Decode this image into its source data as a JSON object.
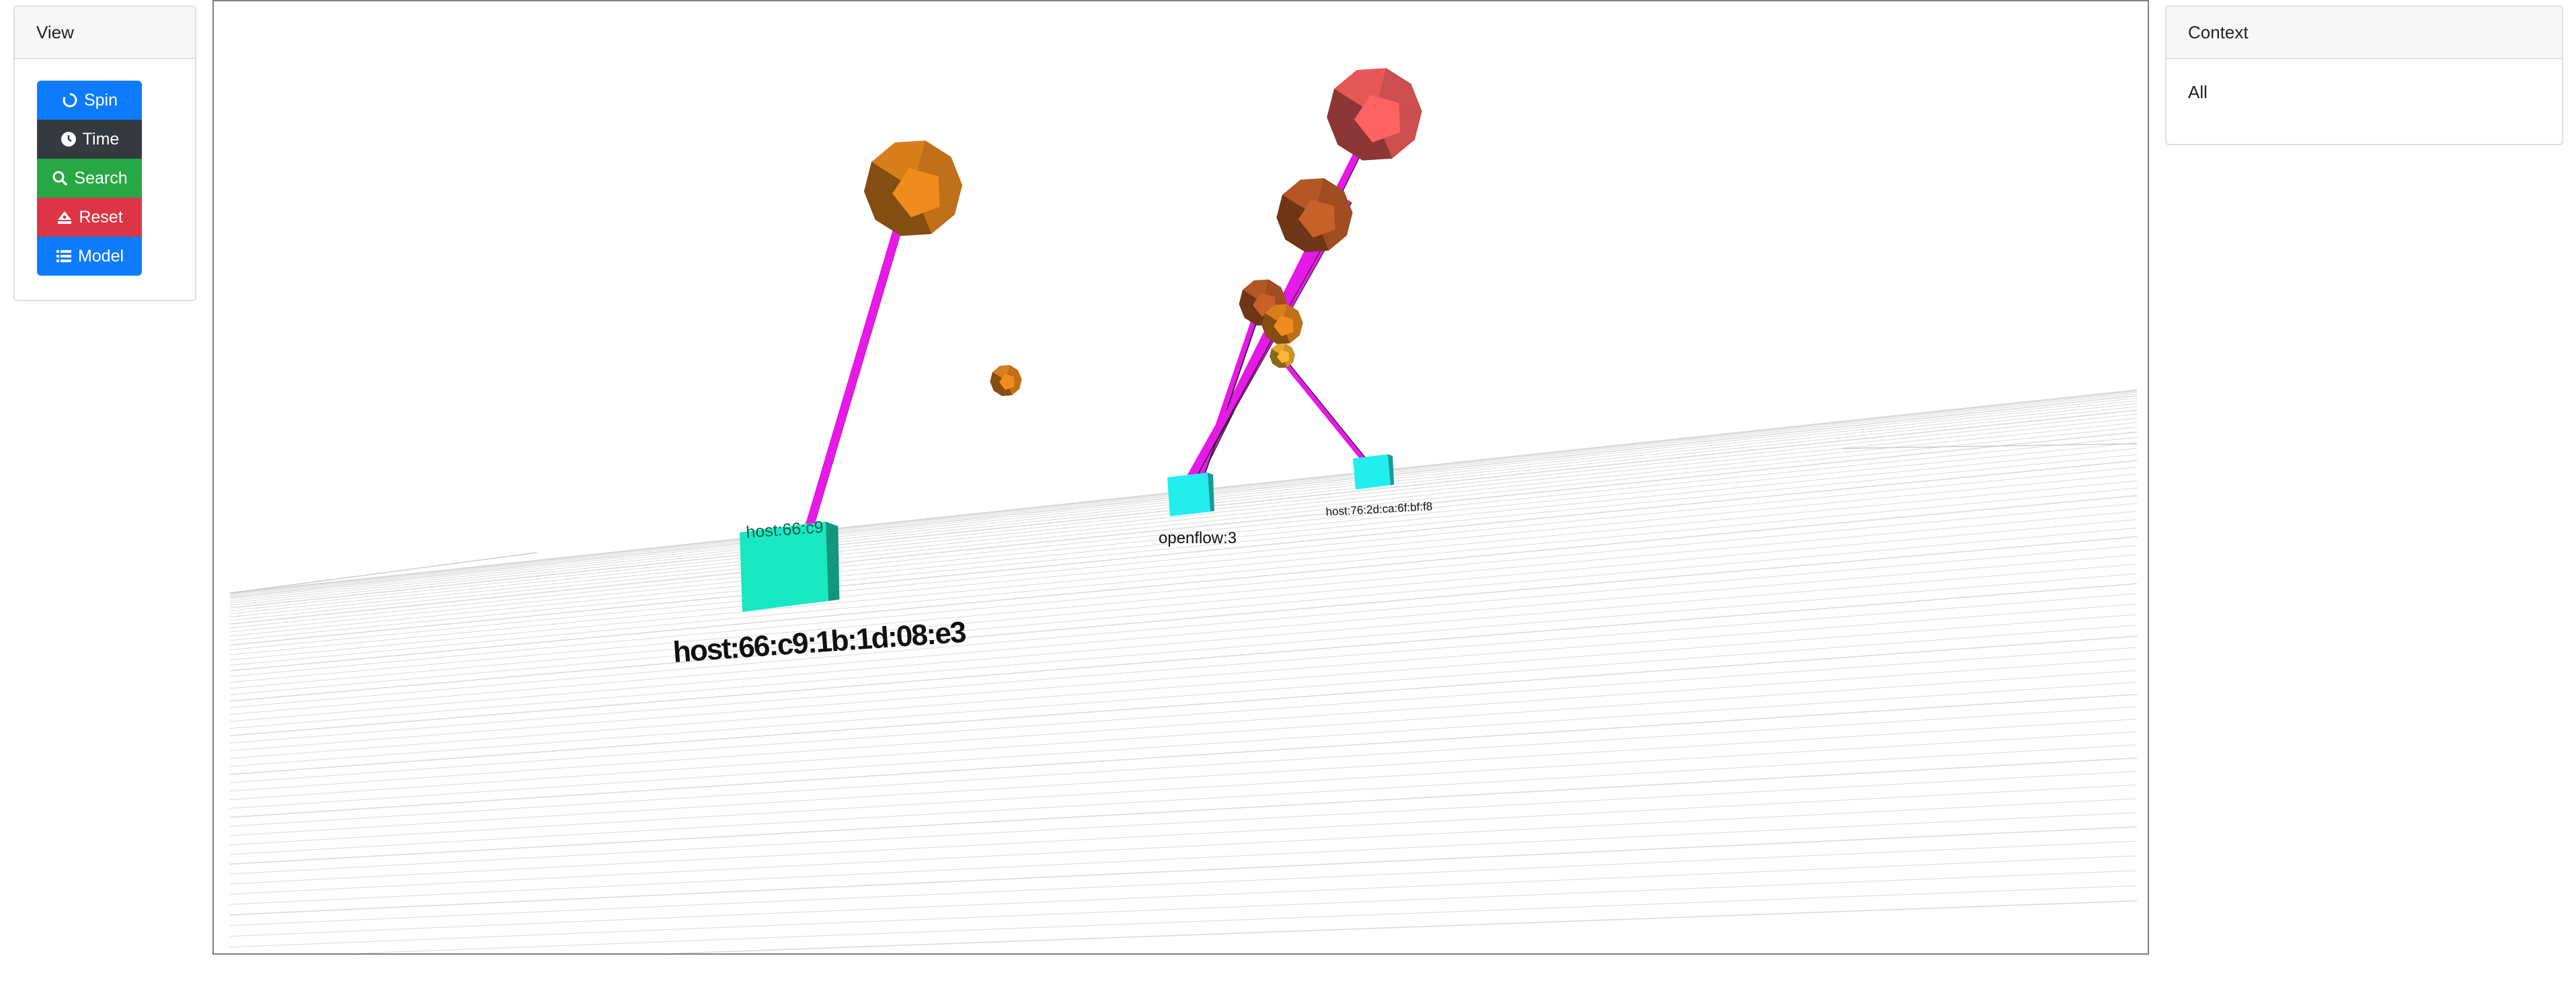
{
  "view_panel": {
    "title": "View",
    "buttons": [
      {
        "label": "Spin",
        "icon": "spin-icon",
        "color": "#0d7bff"
      },
      {
        "label": "Time",
        "icon": "clock-icon",
        "color": "#343a40"
      },
      {
        "label": "Search",
        "icon": "search-icon",
        "color": "#28a745"
      },
      {
        "label": "Reset",
        "icon": "eject-icon",
        "color": "#dc3545"
      },
      {
        "label": "Model",
        "icon": "list-icon",
        "color": "#0d7bff"
      }
    ]
  },
  "context_panel": {
    "title": "Context",
    "value": "All"
  },
  "scene": {
    "node_labels": {
      "host_large": "host:66:c9:1b:1d:08:e3",
      "host_large_face": "host:66:c9",
      "openflow": "openflow:3",
      "host_small": "host:76:2d:ca:6f:bf:f8"
    },
    "colors": {
      "link": "#e619e6",
      "host_node": "#18e8c2",
      "switch_node": "#22eeee",
      "node_orange": "#f08c1e",
      "node_red": "#ff6262",
      "node_rust": "#c8602a",
      "node_yellow": "#ffb833"
    }
  }
}
